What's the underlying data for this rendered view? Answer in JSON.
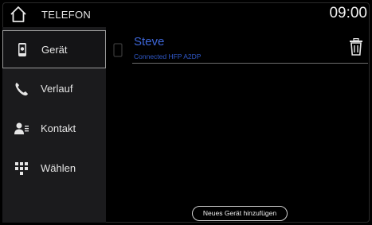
{
  "statusbar": {
    "title": "TELEFON",
    "time": "09:00",
    "home_icon": "home-icon"
  },
  "sidebar": {
    "items": [
      {
        "label": "Gerät",
        "icon": "phone-device-icon",
        "active": true
      },
      {
        "label": "Verlauf",
        "icon": "call-history-icon",
        "active": false
      },
      {
        "label": "Kontakt",
        "icon": "contact-icon",
        "active": false
      },
      {
        "label": "Wählen",
        "icon": "dialpad-icon",
        "active": false
      }
    ]
  },
  "device": {
    "name": "Steve",
    "status": "Connected HFP A2DP",
    "icon": "phone-icon",
    "delete_icon": "trash-icon",
    "name_color": "#3d66d8"
  },
  "actions": {
    "add_device": "Neues Gerät hinzufügen"
  }
}
